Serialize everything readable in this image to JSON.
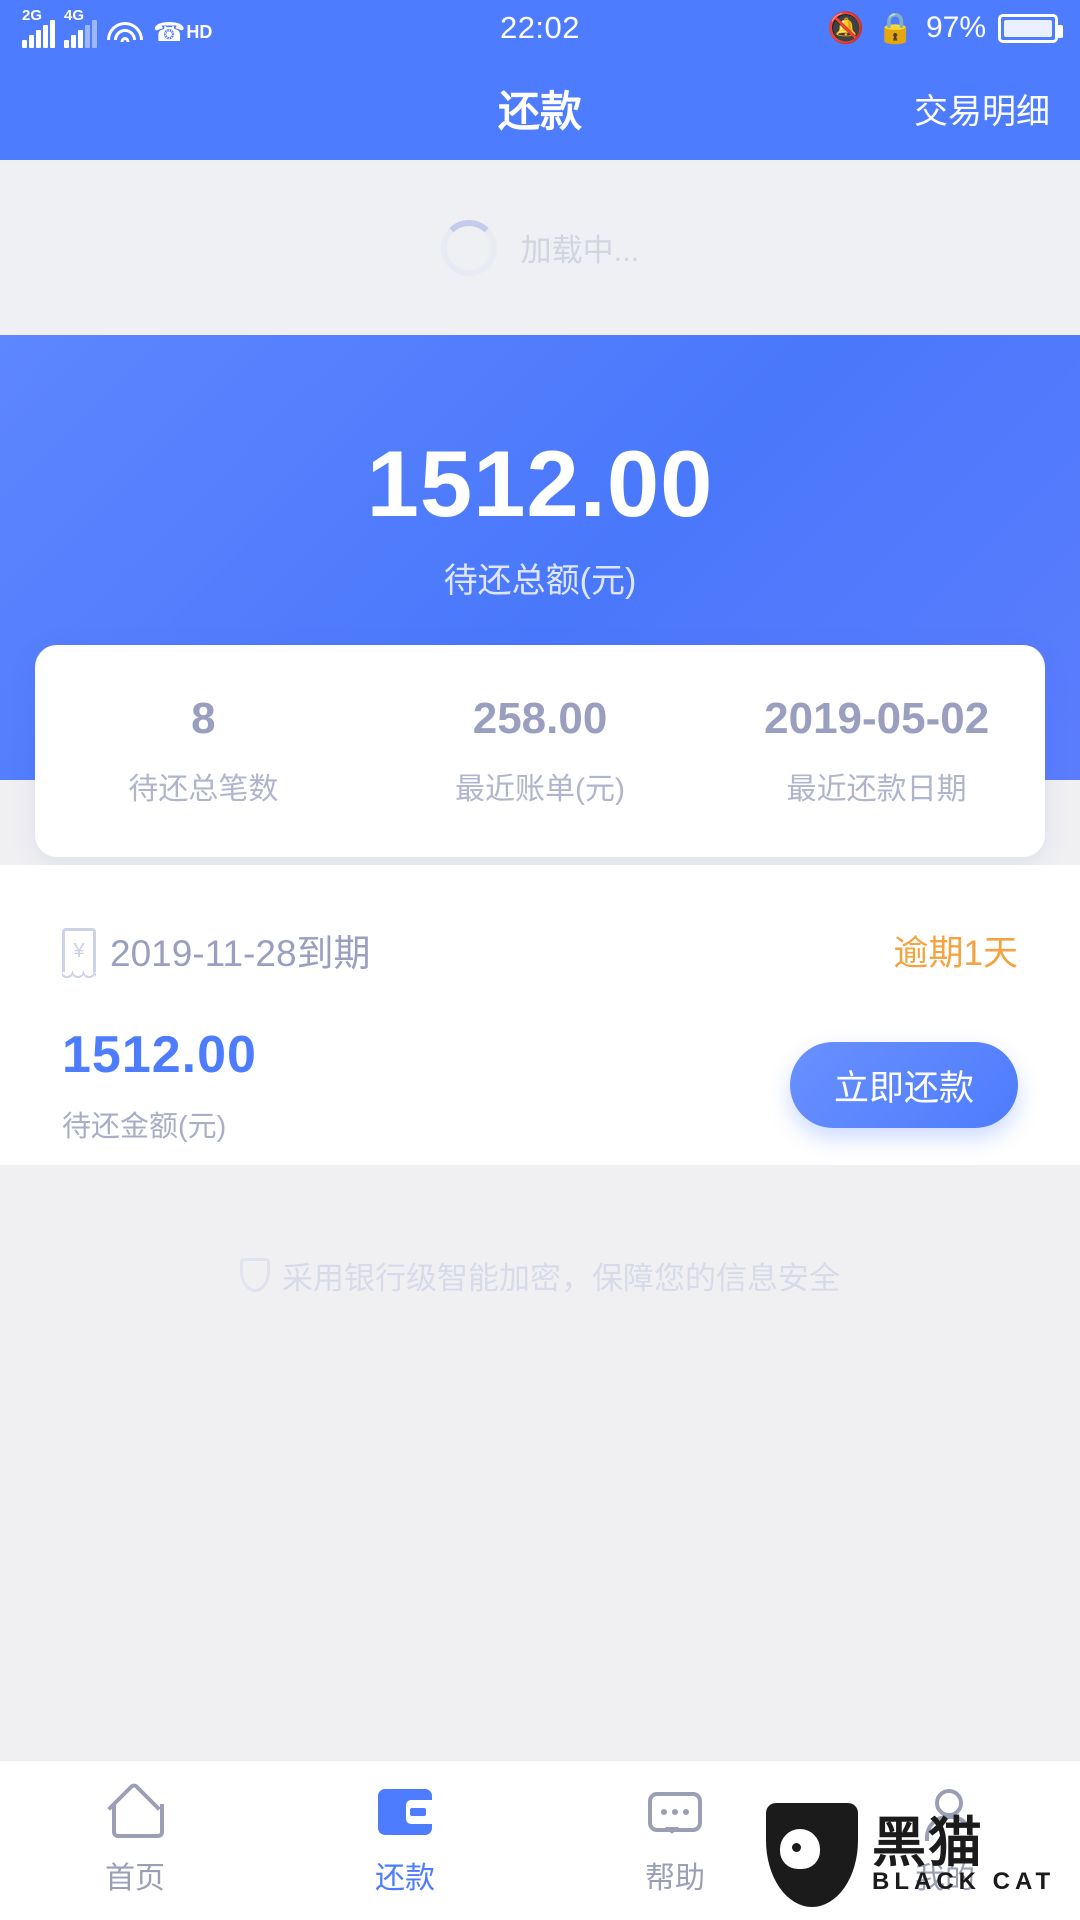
{
  "status_bar": {
    "network_1": "2G",
    "network_2": "4G",
    "voice": "HD",
    "time": "22:02",
    "battery_percent": "97%",
    "icons": [
      "signal-icon",
      "signal-icon",
      "wifi-icon",
      "hd-call-icon",
      "mute-icon",
      "rotation-lock-icon",
      "battery-icon"
    ]
  },
  "navbar": {
    "title": "还款",
    "action": "交易明细"
  },
  "loading": {
    "text": "加载中..."
  },
  "hero": {
    "amount": "1512.00",
    "label": "待还总额(元)"
  },
  "stats": [
    {
      "value": "8",
      "label": "待还总笔数"
    },
    {
      "value": "258.00",
      "label": "最近账单(元)"
    },
    {
      "value": "2019-05-02",
      "label": "最近还款日期"
    }
  ],
  "bill": {
    "due_text": "2019-11-28到期",
    "status": "逾期1天",
    "amount": "1512.00",
    "amount_label": "待还金额(元)",
    "repay_button": "立即还款"
  },
  "footer_note": {
    "text": "采用银行级智能加密，保障您的信息安全"
  },
  "tabbar": [
    {
      "label": "首页",
      "icon": "home-icon",
      "active": false
    },
    {
      "label": "还款",
      "icon": "wallet-icon",
      "active": true
    },
    {
      "label": "帮助",
      "icon": "help-icon",
      "active": false
    },
    {
      "label": "我的",
      "icon": "profile-icon",
      "active": false
    }
  ],
  "watermark": {
    "cn": "黑猫",
    "en": "BLACK CAT"
  },
  "colors": {
    "brand_blue": "#4d7cfe",
    "overdue_orange": "#f5a340",
    "page_bg": "#f0f0f3",
    "muted_text": "#9a9fc0"
  }
}
